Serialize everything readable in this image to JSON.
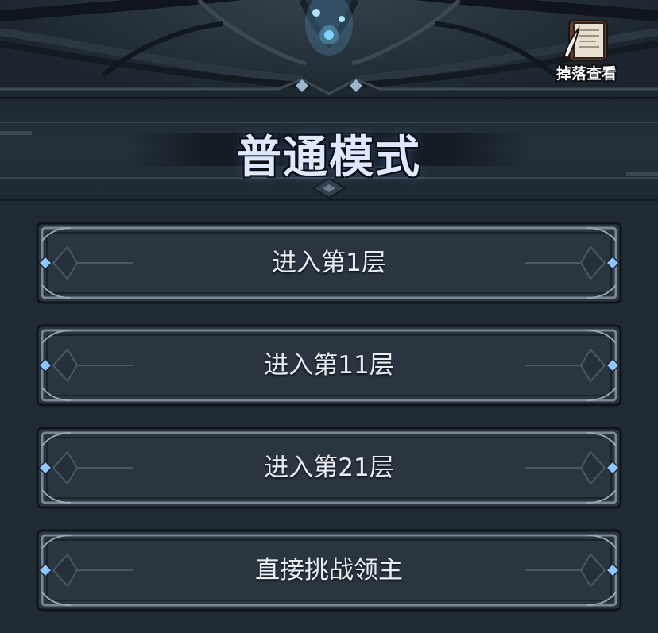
{
  "header": {
    "loot_label": "掉落查看",
    "loot_icon": "scroll-icon"
  },
  "mode": {
    "title": "普通模式"
  },
  "menu": {
    "items": [
      {
        "label": "进入第1层"
      },
      {
        "label": "进入第11层"
      },
      {
        "label": "进入第21层"
      },
      {
        "label": "直接挑战领主"
      }
    ]
  },
  "colors": {
    "background": "#202a33",
    "button_fill": "#2a3540",
    "frame": "#7a8795",
    "gem": "#8fc6ff",
    "title_text": "#dfe8ff",
    "glow": "#7fd3ff"
  }
}
